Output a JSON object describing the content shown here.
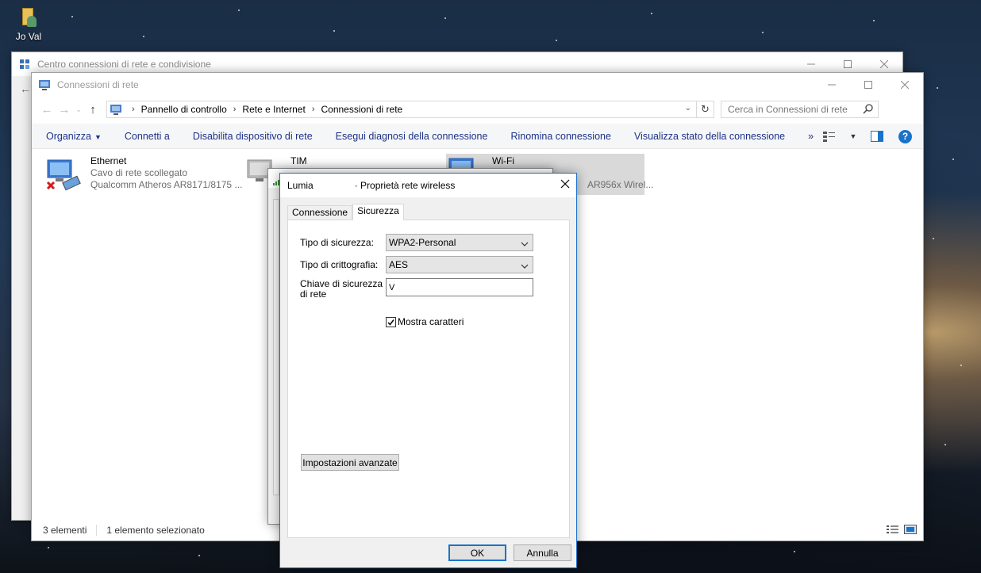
{
  "desktop": {
    "icon_label": "Jo Val"
  },
  "back_window": {
    "title": "Centro connessioni di rete e condivisione"
  },
  "main_window": {
    "title": "Connessioni di rete",
    "address": {
      "crumbs": [
        "Pannello di controllo",
        "Rete e Internet",
        "Connessioni di rete"
      ]
    },
    "search_placeholder": "Cerca in Connessioni di rete",
    "commands": [
      "Organizza",
      "Connetti a",
      "Disabilita dispositivo di rete",
      "Esegui diagnosi della connessione",
      "Rinomina connessione",
      "Visualizza stato della connessione",
      "»"
    ],
    "connections": [
      {
        "name": "Ethernet",
        "status": "Cavo di rete scollegato",
        "device": "Qualcomm Atheros AR8171/8175 ..."
      },
      {
        "name": "TIM",
        "status": "",
        "device": ""
      },
      {
        "name": "Wi-Fi",
        "status": "",
        "device": "AR956x Wirel..."
      }
    ],
    "status": {
      "count": "3 elementi",
      "selected": "1 elemento selezionato"
    }
  },
  "dialog": {
    "title_left": "Lumia",
    "title_right": "· Proprietà rete wireless",
    "tabs": [
      "Connessione",
      "Sicurezza"
    ],
    "active_tab": "Sicurezza",
    "security_type_label": "Tipo di sicurezza:",
    "security_type_value": "WPA2-Personal",
    "encryption_label": "Tipo di crittografia:",
    "encryption_value": "AES",
    "key_label_line1": "Chiave di sicurezza",
    "key_label_line2": "di rete",
    "key_value": "V",
    "show_chars_label": "Mostra caratteri",
    "show_chars_checked": true,
    "advanced_button": "Impostazioni avanzate",
    "ok_button": "OK",
    "cancel_button": "Annulla"
  },
  "colors": {
    "accent": "#1a73c9",
    "command_text": "#1e3287",
    "selected_item": "#d9d9d9"
  }
}
